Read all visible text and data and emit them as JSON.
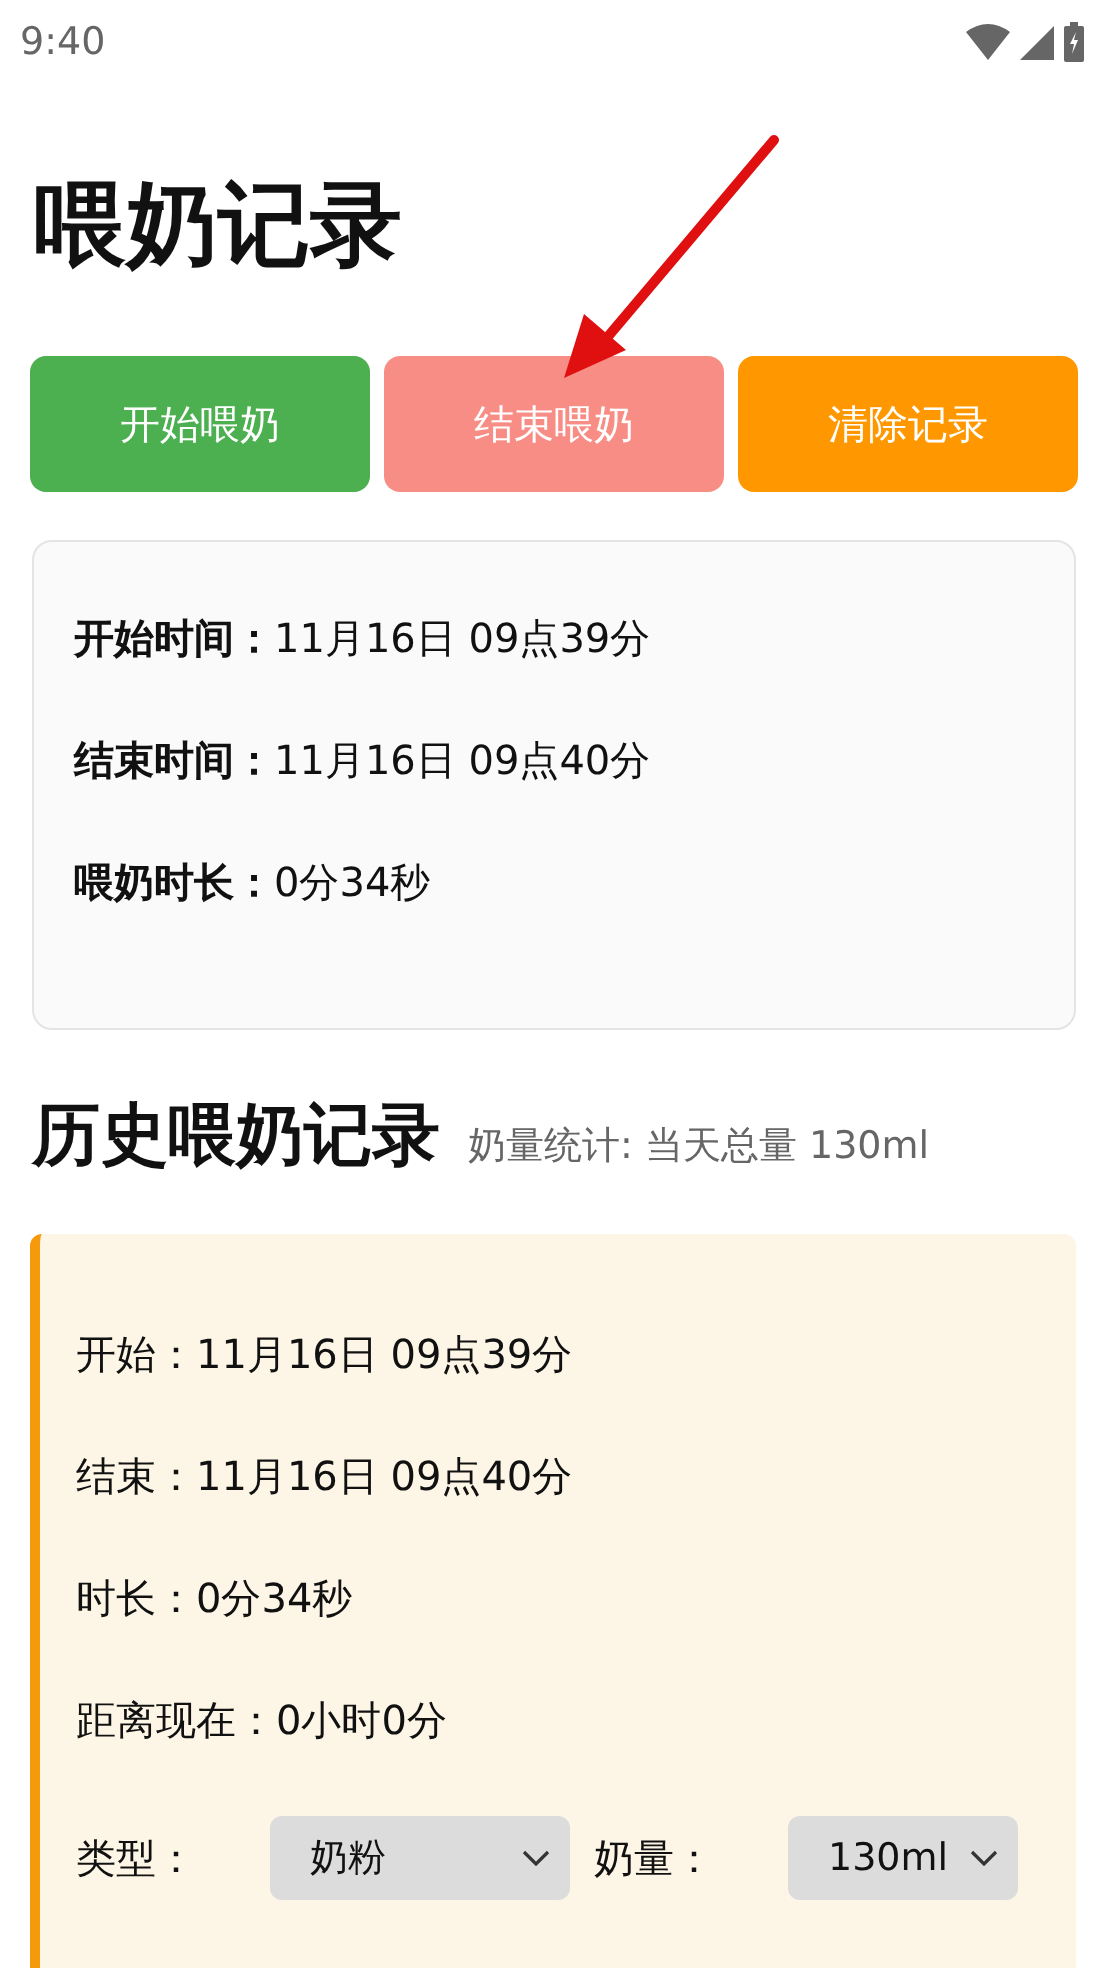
{
  "status_bar": {
    "time": "9:40"
  },
  "title": "喂奶记录",
  "buttons": [
    {
      "label": "开始喂奶",
      "kind": "start",
      "disabled": false
    },
    {
      "label": "结束喂奶",
      "kind": "end",
      "disabled": true
    },
    {
      "label": "清除记录",
      "kind": "clear",
      "disabled": false
    }
  ],
  "current": [
    {
      "label": "开始时间：",
      "value": "11月16日 09点39分"
    },
    {
      "label": "结束时间：",
      "value": "11月16日 09点40分"
    },
    {
      "label": "喂奶时长：",
      "value": "0分34秒"
    }
  ],
  "history": {
    "title": "历史喂奶记录",
    "summary": "奶量统计: 当天总量 130ml",
    "records": [
      {
        "rows": [
          {
            "label": "开始：",
            "value": "11月16日 09点39分"
          },
          {
            "label": "结束：",
            "value": "11月16日 09点40分"
          },
          {
            "label": "时长：",
            "value": "0分34秒"
          },
          {
            "label": "距离现在：",
            "value": "0小时0分"
          }
        ],
        "type_label": "类型：",
        "type_value": "奶粉",
        "amount_label": "奶量：",
        "amount_value": "130ml"
      }
    ]
  }
}
